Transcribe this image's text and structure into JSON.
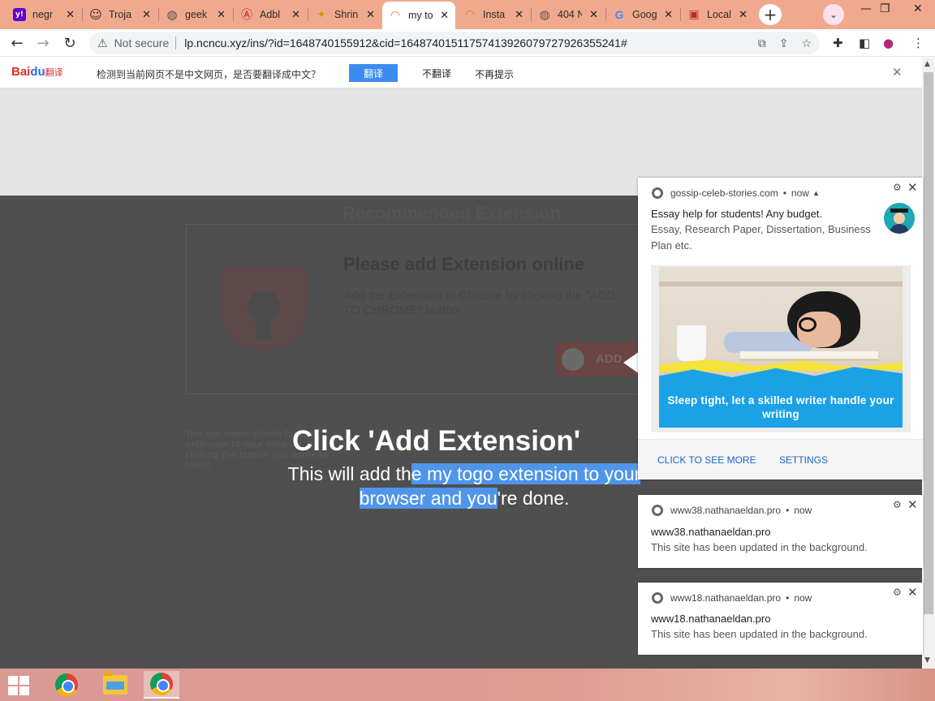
{
  "tabs": [
    {
      "label": "negr",
      "icon": "yahoo-icon",
      "icon_char": "y!",
      "icon_bg": "#6001d2",
      "icon_color": "#ffffff"
    },
    {
      "label": "Troja",
      "icon": "smiley-icon",
      "icon_char": "☺",
      "icon_bg": "transparent",
      "icon_color": "#333333"
    },
    {
      "label": "geek",
      "icon": "globe-icon",
      "icon_char": "◍",
      "icon_bg": "transparent",
      "icon_color": "#555555"
    },
    {
      "label": "Adbl",
      "icon": "anarchy-icon",
      "icon_char": "Ⓐ",
      "icon_bg": "transparent",
      "icon_color": "#c8102e"
    },
    {
      "label": "Shrin",
      "icon": "bee-icon",
      "icon_char": "✦",
      "icon_bg": "transparent",
      "icon_color": "#c79a00"
    },
    {
      "label": "my to",
      "icon": "rainbow-icon",
      "icon_char": "◠",
      "icon_bg": "transparent",
      "icon_color": "#e96a2b",
      "active": true
    },
    {
      "label": "Insta",
      "icon": "rainbow-icon",
      "icon_char": "◠",
      "icon_bg": "transparent",
      "icon_color": "#e96a2b"
    },
    {
      "label": "404 N",
      "icon": "globe-icon",
      "icon_char": "◍",
      "icon_bg": "transparent",
      "icon_color": "#555555"
    },
    {
      "label": "Goog",
      "icon": "google-icon",
      "icon_char": "G",
      "icon_bg": "transparent",
      "icon_color": "#4285f4"
    },
    {
      "label": "Local",
      "icon": "store-icon",
      "icon_char": "▣",
      "icon_bg": "transparent",
      "icon_color": "#b22d2d"
    }
  ],
  "toolbar": {
    "security_label": "Not secure",
    "url": "lp.ncncu.xyz/ins/?id=1648740155912&cid=16487401511757413926079727926355241#"
  },
  "translate_bar": {
    "logo_bai": "Bai",
    "logo_du": "du",
    "logo_fanyi": "翻译",
    "message": "检测到当前网页不是中文网页，是否要翻译成中文？",
    "translate_label": "翻译",
    "no_translate_label": "不翻译",
    "never_label": "不再提示"
  },
  "page": {
    "ghost_title": "Recommended Extension",
    "ghost_heading": "Please add Extension online",
    "ghost_sub": "Add the Extension to Chrome by clicking the \"ADD TO CHROME\" button",
    "ghost_button": "ADD",
    "ghost_small": "The app name stands for the extension to your browser. By clicking the button you agree to terms.",
    "headline": "Click 'Add Extension'",
    "sub_pre": "This will add th",
    "sub_sel": "e my togo extension to your browser and you",
    "sub_post": "'re done."
  },
  "notifications": [
    {
      "source": "gossip-celeb-stories.com",
      "time": "now",
      "title": "Essay help for students! Any budget.",
      "body": "Essay, Research Paper, Dissertation, Business Plan etc.",
      "image_caption": "Sleep tight, let a skilled writer handle your writing",
      "action_primary": "CLICK TO SEE MORE",
      "action_settings": "SETTINGS"
    },
    {
      "source": "www38.nathanaeldan.pro",
      "time": "now",
      "title": "www38.nathanaeldan.pro",
      "body": "This site has been updated in the background."
    },
    {
      "source": "www18.nathanaeldan.pro",
      "time": "now",
      "title": "www18.nathanaeldan.pro",
      "body": "This site has been updated in the background."
    }
  ],
  "colors": {
    "tabstrip_bg": "#f1a98e",
    "translate_button": "#3c8cf0",
    "selection": "#4f95ea",
    "notification_action": "#1a66c8"
  }
}
